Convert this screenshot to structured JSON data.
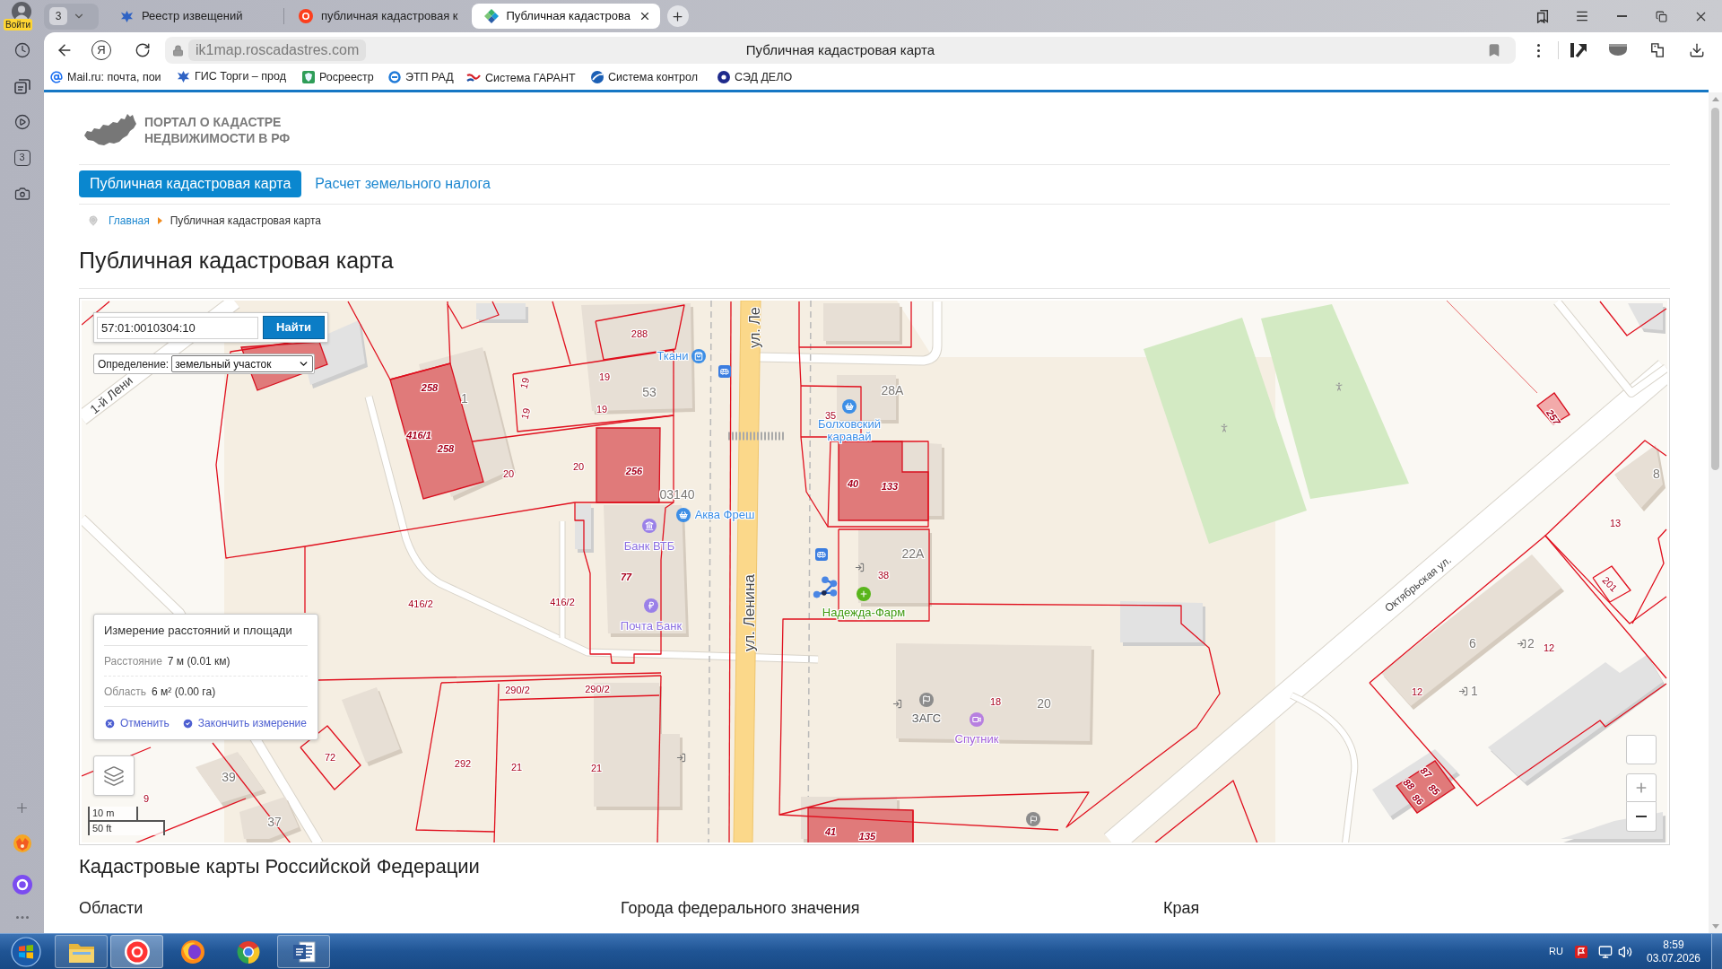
{
  "browser": {
    "profile_label": "Войти",
    "tab_count": "3",
    "tabs": [
      {
        "title": "Реестр извещений",
        "selected": false
      },
      {
        "title": "публичная кадастровая к",
        "selected": false
      },
      {
        "title": "Публичная кадастрова",
        "selected": true
      }
    ],
    "home_logo": "Я",
    "url": "ik1map.roscadastres.com",
    "page_title": "Публичная кадастровая карта",
    "bookmarks": [
      "Mail.ru: почта, пои",
      "ГИС Торги – прод",
      "Росреестр",
      "ЭТП РАД",
      "Система ГАРАНТ",
      "Система контрол",
      "СЭД ДЕЛО"
    ],
    "sidebar_counter": "3"
  },
  "site": {
    "logo_lines": [
      "ПОРТАЛ О КАДАСТРЕ",
      "НЕДВИЖИМОСТИ В РФ"
    ],
    "nav": [
      {
        "label": "Публичная кадастровая карта",
        "selected": true
      },
      {
        "label": "Расчет земельного налога",
        "selected": false
      }
    ],
    "breadcrumbs": [
      "Главная",
      "Публичная кадастровая карта"
    ],
    "heading": "Публичная кадастровая карта"
  },
  "map": {
    "search": {
      "value": "57:01:0010304:10",
      "button": "Найти"
    },
    "definition": {
      "label": "Определение:",
      "value": "земельный участок"
    },
    "measurement": {
      "title": "Измерение расстояний и площади",
      "rows": [
        {
          "label": "Расстояние",
          "value": "7 м (0.01 км)"
        },
        {
          "label": "Область",
          "value": "6 м² (0.00 га)"
        }
      ],
      "actions": [
        "Отменить",
        "Закончить измерение"
      ]
    },
    "scale": [
      "10 m",
      "50 ft"
    ],
    "streets": [
      "1-й Лени",
      "ул. Ле",
      "ул. Ленина",
      "Октябрьская ул."
    ],
    "parcel_numbers": [
      "288",
      "19",
      "19",
      "19",
      "19",
      "258",
      "416/1",
      "258",
      "20",
      "20",
      "256",
      "77",
      "416/2",
      "416/2",
      "290/2",
      "290/2",
      "292",
      "21",
      "21",
      "72",
      "9",
      "35",
      "40",
      "133",
      "38",
      "18",
      "41",
      "135",
      "257",
      "13",
      "201",
      "12",
      "12",
      "87",
      "85",
      "88",
      "86"
    ],
    "house_numbers": [
      "1",
      "53",
      "03140",
      "28А",
      "22А",
      "20",
      "6",
      "2",
      "1",
      "8",
      "39",
      "37"
    ],
    "places": [
      {
        "name": "Ткани",
        "kind": "shop"
      },
      {
        "name": "Болховский каравай",
        "kind": "shop"
      },
      {
        "name": "Аква Фреш",
        "kind": "shop"
      },
      {
        "name": "Банк ВТБ",
        "kind": "bank"
      },
      {
        "name": "Почта Банк",
        "kind": "bank"
      },
      {
        "name": "Надежда-Фарм",
        "kind": "pharmacy"
      },
      {
        "name": "ЗАГС",
        "kind": "office"
      },
      {
        "name": "Спутник",
        "kind": "cinema"
      }
    ]
  },
  "catalog": {
    "title": "Кадастровые карты Российской Федерации",
    "columns": [
      "Области",
      "Города федерального значения",
      "Края"
    ]
  },
  "taskbar": {
    "apps": [
      {
        "open": true,
        "selected": false
      },
      {
        "open": true,
        "selected": true
      },
      {
        "open": false,
        "selected": false
      },
      {
        "open": false,
        "selected": false
      },
      {
        "open": true,
        "selected": false
      }
    ],
    "language": "RU",
    "time": "8:59",
    "date": "03.07.2026"
  }
}
